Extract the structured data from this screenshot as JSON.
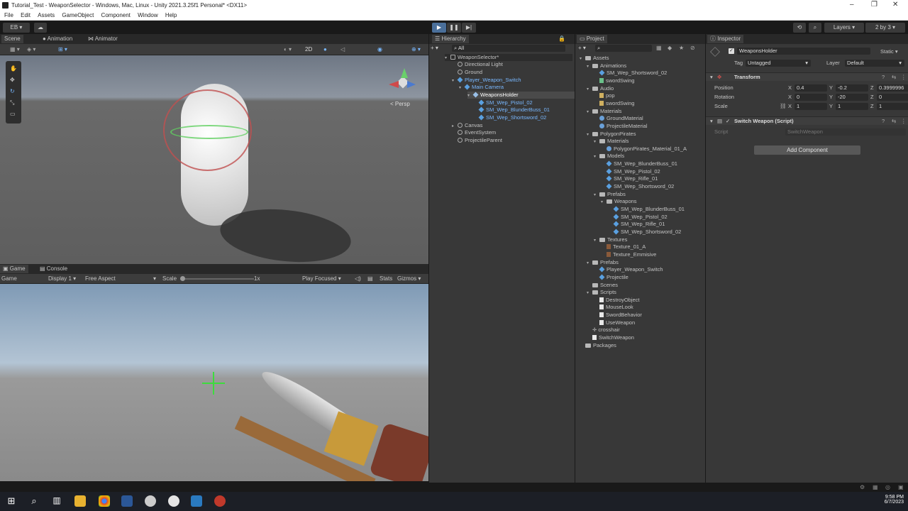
{
  "window": {
    "title": "Tutorial_Test - WeaponSelector - Windows, Mac, Linux - Unity 2021.3.25f1 Personal* <DX11>"
  },
  "menu": [
    "File",
    "Edit",
    "Assets",
    "GameObject",
    "Component",
    "Window",
    "Help"
  ],
  "toolbar": {
    "account": "EB",
    "layers": "Layers",
    "layout": "2 by 3"
  },
  "scene_tabs": [
    "Scene",
    "Animation",
    "Animator"
  ],
  "scene": {
    "persp": "< Persp",
    "btn_2d": "2D"
  },
  "game_tabs": [
    "Game",
    "Console"
  ],
  "game_bar": {
    "game": "Game",
    "display": "Display 1",
    "aspect": "Free Aspect",
    "scale": "Scale",
    "scale_val": "1x",
    "play_focused": "Play Focused",
    "stats": "Stats",
    "gizmos": "Gizmos"
  },
  "hierarchy": {
    "title": "Hierarchy",
    "search": "All",
    "items": [
      "WeaponSelector*",
      "Directional Light",
      "Ground",
      "Player_Weapon_Switch",
      "Main Camera",
      "WeaponsHolder",
      "SM_Wep_Pistol_02",
      "SM_Wep_BlunderBuss_01",
      "SM_Wep_Shortsword_02",
      "Canvas",
      "EventSystem",
      "ProjectileParent"
    ]
  },
  "project": {
    "title": "Project",
    "items": [
      "Assets",
      "Animations",
      "SM_Wep_Shortsword_02",
      "swordSwing",
      "Audio",
      "pop",
      "swordSwing",
      "Materials",
      "GroundMaterial",
      "ProjectileMaterial",
      "PolygonPirates",
      "Materials",
      "PolygonPirates_Material_01_A",
      "Models",
      "SM_Wep_BlunderBuss_01",
      "SM_Wep_Pistol_02",
      "SM_Wep_Rifle_01",
      "SM_Wep_Shortsword_02",
      "Prefabs",
      "Weapons",
      "SM_Wep_BlunderBuss_01",
      "SM_Wep_Pistol_02",
      "SM_Wep_Rifle_01",
      "SM_Wep_Shortsword_02",
      "Textures",
      "Texture_01_A",
      "Texture_Emmisive",
      "Prefabs",
      "Player_Weapon_Switch",
      "Projectile",
      "Scenes",
      "Scripts",
      "DestroyObject",
      "MouseLook",
      "SwordBehavior",
      "UseWeapon",
      "crosshair",
      "SwitchWeapon",
      "Packages"
    ]
  },
  "inspector": {
    "title": "Inspector",
    "object_name": "WeaponsHolder",
    "static": "Static",
    "tag_label": "Tag",
    "tag": "Untagged",
    "layer_label": "Layer",
    "layer": "Default",
    "transform": "Transform",
    "position_label": "Position",
    "rotation_label": "Rotation",
    "scale_label": "Scale",
    "pos": {
      "x": "0.4",
      "y": "-0.2",
      "z": "0.3999996"
    },
    "rot": {
      "x": "0",
      "y": "-20",
      "z": "0"
    },
    "scl": {
      "x": "1",
      "y": "1",
      "z": "1"
    },
    "axis": {
      "x": "X",
      "y": "Y",
      "z": "Z"
    },
    "script_component": "Switch Weapon (Script)",
    "script_label": "Script",
    "script_value": "SwitchWeapon",
    "add_component": "Add Component"
  },
  "clock": {
    "time": "9:58 PM",
    "date": "6/7/2023"
  }
}
